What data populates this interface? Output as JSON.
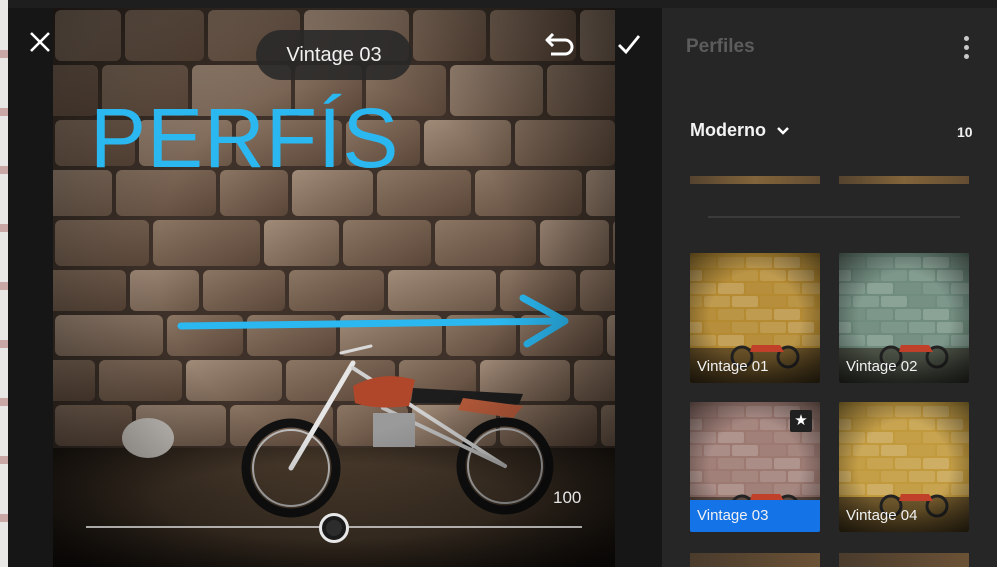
{
  "editor": {
    "profile_name": "Vintage 03",
    "overlay_title": "PERFÍS",
    "amount_value": "100",
    "amount_fraction": 0.5,
    "accent_color": "#2bb7ef",
    "icons": {
      "close": "close-icon",
      "undo": "undo-icon",
      "confirm": "checkmark-icon"
    }
  },
  "panel": {
    "title": "Perfiles",
    "group": {
      "name": "Moderno",
      "count": "10"
    },
    "profiles": [
      {
        "label": "Vintage 01",
        "selected": false,
        "favorite": false,
        "tint": "#b48a32"
      },
      {
        "label": "Vintage 02",
        "selected": false,
        "favorite": false,
        "tint": "#6f8c7e"
      },
      {
        "label": "Vintage 03",
        "selected": true,
        "favorite": true,
        "tint": "#9c7a72"
      },
      {
        "label": "Vintage 04",
        "selected": false,
        "favorite": false,
        "tint": "#c29a3e"
      }
    ],
    "selected_color": "#1473e6"
  }
}
